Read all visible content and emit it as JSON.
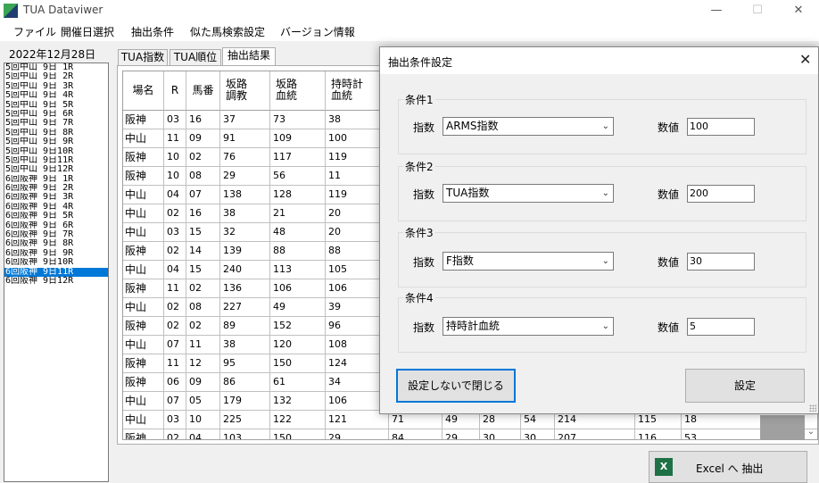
{
  "window": {
    "title": "TUA Dataviwer",
    "min": "—",
    "max": "☐",
    "close": "✕"
  },
  "menu": [
    "ファイル",
    "開催日選択",
    "抽出条件",
    "似た馬検索設定",
    "バージョン情報"
  ],
  "date_label": "2022年12月28日",
  "races": [
    "5回中山 9日 1R",
    "5回中山 9日 2R",
    "5回中山 9日 3R",
    "5回中山 9日 4R",
    "5回中山 9日 5R",
    "5回中山 9日 6R",
    "5回中山 9日 7R",
    "5回中山 9日 8R",
    "5回中山 9日 9R",
    "5回中山 9日10R",
    "5回中山 9日11R",
    "5回中山 9日12R",
    "6回阪神 9日 1R",
    "6回阪神 9日 2R",
    "6回阪神 9日 3R",
    "6回阪神 9日 4R",
    "6回阪神 9日 5R",
    "6回阪神 9日 6R",
    "6回阪神 9日 7R",
    "6回阪神 9日 8R",
    "6回阪神 9日 9R",
    "6回阪神 9日10R",
    "6回阪神 9日11R",
    "6回阪神 9日12R"
  ],
  "selected_race_index": 22,
  "tabs": [
    "TUA指数",
    "TUA順位",
    "抽出結果"
  ],
  "active_tab_index": 2,
  "table": {
    "headers": [
      "場名",
      "R",
      "馬番",
      "坂路\n調教",
      "坂路\n血統",
      "持時計\n血統",
      "",
      "",
      "",
      "",
      "",
      "",
      ""
    ],
    "rows": [
      [
        "阪神",
        "03",
        "16",
        "37",
        "73",
        "38"
      ],
      [
        "中山",
        "11",
        "09",
        "91",
        "109",
        "100"
      ],
      [
        "阪神",
        "10",
        "02",
        "76",
        "117",
        "119"
      ],
      [
        "阪神",
        "10",
        "08",
        "29",
        "56",
        "11"
      ],
      [
        "中山",
        "04",
        "07",
        "138",
        "128",
        "119"
      ],
      [
        "中山",
        "02",
        "16",
        "38",
        "21",
        "20"
      ],
      [
        "中山",
        "03",
        "15",
        "32",
        "48",
        "20"
      ],
      [
        "阪神",
        "02",
        "14",
        "139",
        "88",
        "88"
      ],
      [
        "中山",
        "04",
        "15",
        "240",
        "113",
        "105"
      ],
      [
        "阪神",
        "11",
        "02",
        "136",
        "106",
        "106"
      ],
      [
        "中山",
        "02",
        "08",
        "227",
        "49",
        "39"
      ],
      [
        "阪神",
        "02",
        "02",
        "89",
        "152",
        "96"
      ],
      [
        "中山",
        "07",
        "11",
        "38",
        "120",
        "108"
      ],
      [
        "阪神",
        "11",
        "12",
        "95",
        "150",
        "124"
      ],
      [
        "阪神",
        "06",
        "09",
        "86",
        "61",
        "34"
      ],
      [
        "中山",
        "07",
        "05",
        "179",
        "132",
        "106"
      ],
      [
        "中山",
        "03",
        "10",
        "225",
        "122",
        "121",
        "71",
        "49",
        "28",
        "54",
        "214",
        "115",
        "18"
      ],
      [
        "阪神",
        "02",
        "04",
        "103",
        "150",
        "29",
        "84",
        "29",
        "30",
        "30",
        "207",
        "116",
        "53"
      ]
    ]
  },
  "excel_button": {
    "icon": "excel-icon",
    "label": "Excel へ 抽出"
  },
  "dialog": {
    "title": "抽出条件設定",
    "close": "✕",
    "index_label": "指数",
    "value_label": "数値",
    "conditions": [
      {
        "label": "条件1",
        "index": "ARMS指数",
        "value": "100"
      },
      {
        "label": "条件2",
        "index": "TUA指数",
        "value": "200"
      },
      {
        "label": "条件3",
        "index": "F指数",
        "value": "30"
      },
      {
        "label": "条件4",
        "index": "持時計血統",
        "value": "5"
      }
    ],
    "close_without_saving": "設定しないで閉じる",
    "apply": "設定"
  }
}
